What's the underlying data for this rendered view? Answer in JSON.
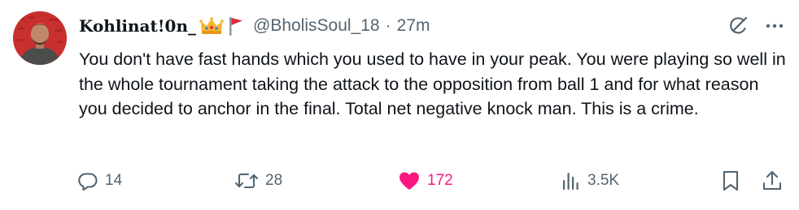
{
  "tweet": {
    "display_name": "Kohlinat!0n_",
    "handle": "@BholisSoul_18",
    "separator": "·",
    "time": "27m",
    "text": "You don't have fast hands which you used to have in your peak. You were playing so well in the whole tournament taking the attack to the opposition from ball 1 and for what reason you decided to anchor in the final. Total net negative knock man. This is a crime.",
    "badges": [
      "crown-emoji",
      "red-flag-emoji"
    ]
  },
  "actions": {
    "replies": "14",
    "reposts": "28",
    "likes": "172",
    "views": "3.5K"
  },
  "icons": {
    "reply": "reply-icon",
    "repost": "repost-icon",
    "like": "heart-icon",
    "views": "views-icon",
    "bookmark": "bookmark-icon",
    "share": "share-icon",
    "grok": "grok-icon",
    "more": "more-icon"
  },
  "colors": {
    "text": "#0f1419",
    "secondary": "#536471",
    "like_active": "#f91880",
    "background": "#ffffff"
  }
}
